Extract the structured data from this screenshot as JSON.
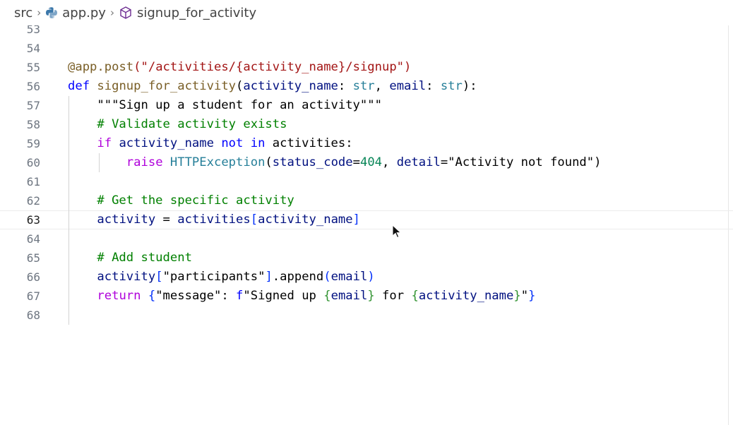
{
  "breadcrumb": {
    "items": [
      {
        "label": "src",
        "icon": null
      },
      {
        "label": "app.py",
        "icon": "python-icon"
      },
      {
        "label": "signup_for_activity",
        "icon": "cube-icon"
      }
    ]
  },
  "editor": {
    "current_line": 63,
    "lines": [
      {
        "n": "53",
        "tokens": []
      },
      {
        "n": "54",
        "tokens": []
      },
      {
        "n": "55",
        "tokens": [
          {
            "t": "@app.",
            "c": "tok-dec"
          },
          {
            "t": "post",
            "c": "tok-fn"
          },
          {
            "t": "(\"/activities/",
            "c": "tok-str"
          },
          {
            "t": "{activity_name}",
            "c": "tok-str"
          },
          {
            "t": "/signup\")",
            "c": "tok-str"
          }
        ]
      },
      {
        "n": "56",
        "tokens": [
          {
            "t": "def ",
            "c": "tok-kw2"
          },
          {
            "t": "signup_for_activity",
            "c": "tok-fn"
          },
          {
            "t": "(",
            "c": "tok-plain"
          },
          {
            "t": "activity_name",
            "c": "tok-param"
          },
          {
            "t": ": ",
            "c": "tok-plain"
          },
          {
            "t": "str",
            "c": "tok-type"
          },
          {
            "t": ", ",
            "c": "tok-plain"
          },
          {
            "t": "email",
            "c": "tok-param"
          },
          {
            "t": ": ",
            "c": "tok-plain"
          },
          {
            "t": "str",
            "c": "tok-type"
          },
          {
            "t": "):",
            "c": "tok-plain"
          }
        ]
      },
      {
        "n": "57",
        "tokens": [
          {
            "t": "    \"\"\"Sign up a student for an activity\"\"\"",
            "c": "tok-plain"
          }
        ]
      },
      {
        "n": "58",
        "tokens": [
          {
            "t": "    # Validate activity exists",
            "c": "tok-cm"
          }
        ]
      },
      {
        "n": "59",
        "tokens": [
          {
            "t": "    ",
            "c": "tok-plain"
          },
          {
            "t": "if ",
            "c": "tok-kw"
          },
          {
            "t": "activity_name ",
            "c": "tok-var"
          },
          {
            "t": "not in ",
            "c": "tok-kw2"
          },
          {
            "t": "activities:",
            "c": "tok-plain"
          }
        ]
      },
      {
        "n": "60",
        "tokens": [
          {
            "t": "        ",
            "c": "tok-plain"
          },
          {
            "t": "raise ",
            "c": "tok-kw"
          },
          {
            "t": "HTTPException",
            "c": "tok-type"
          },
          {
            "t": "(",
            "c": "tok-plain"
          },
          {
            "t": "status_code",
            "c": "tok-param"
          },
          {
            "t": "=",
            "c": "tok-plain"
          },
          {
            "t": "404",
            "c": "tok-num"
          },
          {
            "t": ", ",
            "c": "tok-plain"
          },
          {
            "t": "detail",
            "c": "tok-param"
          },
          {
            "t": "=",
            "c": "tok-plain"
          },
          {
            "t": "\"Activity not found\"",
            "c": "tok-plain"
          },
          {
            "t": ")",
            "c": "tok-plain"
          }
        ]
      },
      {
        "n": "61",
        "tokens": []
      },
      {
        "n": "62",
        "tokens": [
          {
            "t": "    # Get the specific activity",
            "c": "tok-cm"
          }
        ]
      },
      {
        "n": "63",
        "tokens": [
          {
            "t": "    ",
            "c": "tok-plain"
          },
          {
            "t": "activity ",
            "c": "tok-var"
          },
          {
            "t": "= ",
            "c": "tok-plain"
          },
          {
            "t": "activities",
            "c": "tok-var"
          },
          {
            "t": "[",
            "c": "tok-brk"
          },
          {
            "t": "activity_name",
            "c": "tok-var"
          },
          {
            "t": "]",
            "c": "tok-brk"
          }
        ]
      },
      {
        "n": "64",
        "tokens": []
      },
      {
        "n": "65",
        "tokens": [
          {
            "t": "    # Add student",
            "c": "tok-cm"
          }
        ]
      },
      {
        "n": "66",
        "tokens": [
          {
            "t": "    ",
            "c": "tok-plain"
          },
          {
            "t": "activity",
            "c": "tok-var"
          },
          {
            "t": "[",
            "c": "tok-brk"
          },
          {
            "t": "\"participants\"",
            "c": "tok-plain"
          },
          {
            "t": "]",
            "c": "tok-brk"
          },
          {
            "t": ".append",
            "c": "tok-plain"
          },
          {
            "t": "(",
            "c": "tok-brk"
          },
          {
            "t": "email",
            "c": "tok-var"
          },
          {
            "t": ")",
            "c": "tok-brk"
          }
        ]
      },
      {
        "n": "67",
        "tokens": [
          {
            "t": "    ",
            "c": "tok-plain"
          },
          {
            "t": "return ",
            "c": "tok-kw"
          },
          {
            "t": "{",
            "c": "tok-brk"
          },
          {
            "t": "\"message\"",
            "c": "tok-plain"
          },
          {
            "t": ": ",
            "c": "tok-plain"
          },
          {
            "t": "f",
            "c": "tok-kw2"
          },
          {
            "t": "\"Signed up ",
            "c": "tok-plain"
          },
          {
            "t": "{",
            "c": "tok-brk2"
          },
          {
            "t": "email",
            "c": "tok-var"
          },
          {
            "t": "}",
            "c": "tok-brk2"
          },
          {
            "t": " for ",
            "c": "tok-plain"
          },
          {
            "t": "{",
            "c": "tok-brk2"
          },
          {
            "t": "activity_name",
            "c": "tok-var"
          },
          {
            "t": "}",
            "c": "tok-brk2"
          },
          {
            "t": "\"",
            "c": "tok-plain"
          },
          {
            "t": "}",
            "c": "tok-brk"
          }
        ]
      },
      {
        "n": "68",
        "tokens": []
      }
    ]
  },
  "colors": {
    "keyword": "#af00db",
    "function": "#795e26",
    "string": "#a31515",
    "comment": "#008000",
    "number": "#098658",
    "type": "#267f99",
    "variable": "#001080"
  }
}
